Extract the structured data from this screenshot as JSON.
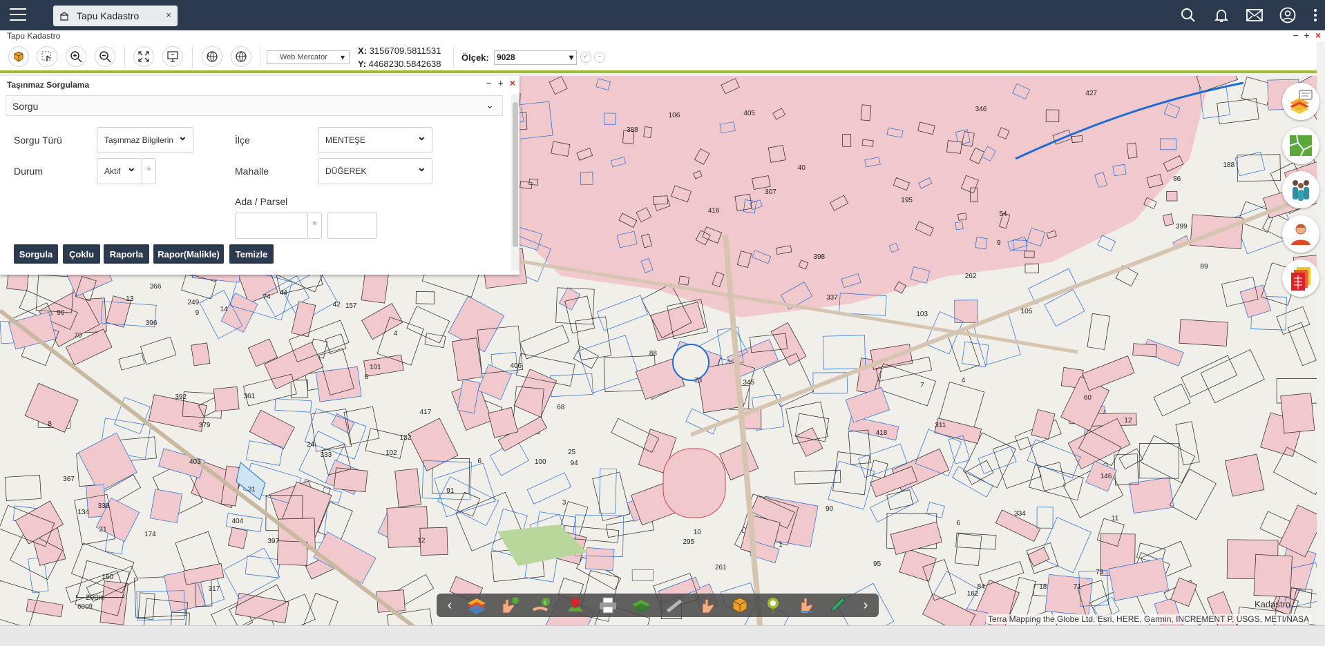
{
  "app": {
    "tab_label": "Tapu Kadastro",
    "tab_close": "×",
    "window_title": "Tapu Kadastro",
    "window_controls": [
      "−",
      "+",
      "×"
    ]
  },
  "toolbar": {
    "projection": "Web Mercator",
    "x_label": "X:",
    "x_value": "3156709.5811531",
    "y_label": "Y:",
    "y_value": "4468230.5842638",
    "scale_label": "Ölçek:",
    "scale_value": "9028",
    "scale_ok": "✓",
    "scale_no": "−"
  },
  "panel": {
    "title": "Taşınmaz Sorgulama",
    "controls": [
      "−",
      "+",
      "×"
    ],
    "section": "Sorgu",
    "fields": {
      "sorgu_turu_label": "Sorgu Türü",
      "sorgu_turu_value": "Taşınmaz Bilgilerin",
      "durum_label": "Durum",
      "durum_value": "Aktif",
      "ilce_label": "İlçe",
      "ilce_value": "MENTEŞE",
      "mahalle_label": "Mahalle",
      "mahalle_value": "DÜĞEREK",
      "ada_parsel_label": "Ada / Parsel",
      "ada_value": "",
      "parsel_value": "",
      "star": "*"
    },
    "buttons": {
      "sorgula": "Sorgula",
      "coklu": "Çoklu",
      "raporla": "Raporla",
      "rapor_malikle": "Rapor(Malikle)",
      "temizle": "Temizle"
    }
  },
  "map": {
    "layer_label": "Kadastro",
    "attribution": "Terra Mapping the Globe Ltd, Esri, HERE, Garmin, INCREMENT P, USGS, METI/NASA",
    "scalebar": "200m",
    "scalebar_ft": "600ft",
    "parcel_numbers": [
      "68",
      "74",
      "9",
      "4",
      "71",
      "6",
      "100",
      "101",
      "102",
      "103",
      "105",
      "106",
      "96",
      "84",
      "4",
      "90",
      "88",
      "89",
      "86",
      "91",
      "18",
      "44",
      "1",
      "333",
      "334",
      "337",
      "295",
      "338",
      "54",
      "134",
      "132",
      "6",
      "174",
      "146",
      "195",
      "367",
      "366",
      "14",
      "361",
      "12",
      "70",
      "73",
      "60",
      "95",
      "94",
      "21",
      "25",
      "24",
      "42",
      "40",
      "261",
      "262",
      "345",
      "346",
      "399",
      "398",
      "397",
      "396",
      "403",
      "404",
      "405",
      "406",
      "8",
      "7",
      "6",
      "13",
      "427",
      "416",
      "418",
      "417",
      "392",
      "31",
      "3",
      "9",
      "11",
      "10",
      "12",
      "249",
      "188",
      "162",
      "157",
      "160",
      "311",
      "307",
      "379",
      "317",
      "388",
      "73"
    ]
  },
  "icons": {
    "menu": "hamburger-icon",
    "tab": "tapu-icon",
    "search": "search-icon",
    "bell": "bell-icon",
    "mail": "mail-icon",
    "user": "user-icon",
    "more": "more-vertical-icon"
  }
}
